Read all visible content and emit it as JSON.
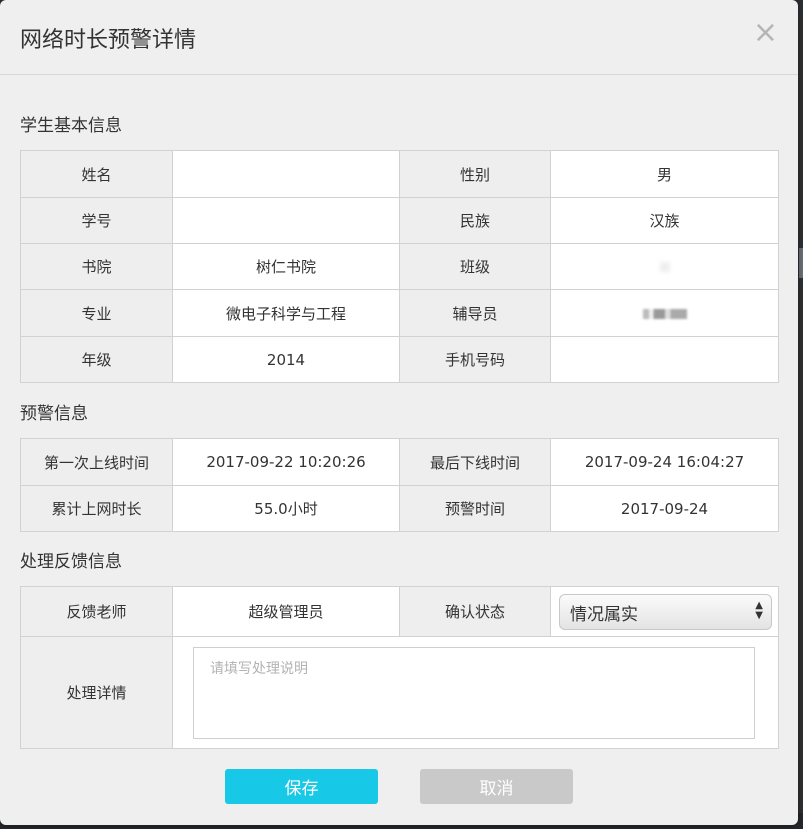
{
  "modal": {
    "title": "网络时长预警详情",
    "close_icon": "×"
  },
  "sections": {
    "student": "学生基本信息",
    "warning": "预警信息",
    "feedback": "处理反馈信息"
  },
  "student": {
    "name_label": "姓名",
    "name_value": "",
    "gender_label": "性别",
    "gender_value": "男",
    "id_label": "学号",
    "id_value": "",
    "ethnicity_label": "民族",
    "ethnicity_value": "汉族",
    "college_label": "书院",
    "college_value": "树仁书院",
    "class_label": "班级",
    "class_value": "",
    "major_label": "专业",
    "major_value": "微电子科学与工程",
    "counselor_label": "辅导员",
    "counselor_value": "",
    "grade_label": "年级",
    "grade_value": "2014",
    "phone_label": "手机号码",
    "phone_value": ""
  },
  "warning": {
    "first_online_label": "第一次上线时间",
    "first_online_value": "2017-09-22 10:20:26",
    "last_offline_label": "最后下线时间",
    "last_offline_value": "2017-09-24 16:04:27",
    "total_label": "累计上网时长",
    "total_value": "55.0小时",
    "warn_time_label": "预警时间",
    "warn_time_value": "2017-09-24"
  },
  "feedback": {
    "teacher_label": "反馈老师",
    "teacher_value": "超级管理员",
    "status_label": "确认状态",
    "status_value": "情况属实",
    "details_label": "处理详情",
    "details_placeholder": "请填写处理说明"
  },
  "buttons": {
    "save": "保存",
    "cancel": "取消"
  }
}
